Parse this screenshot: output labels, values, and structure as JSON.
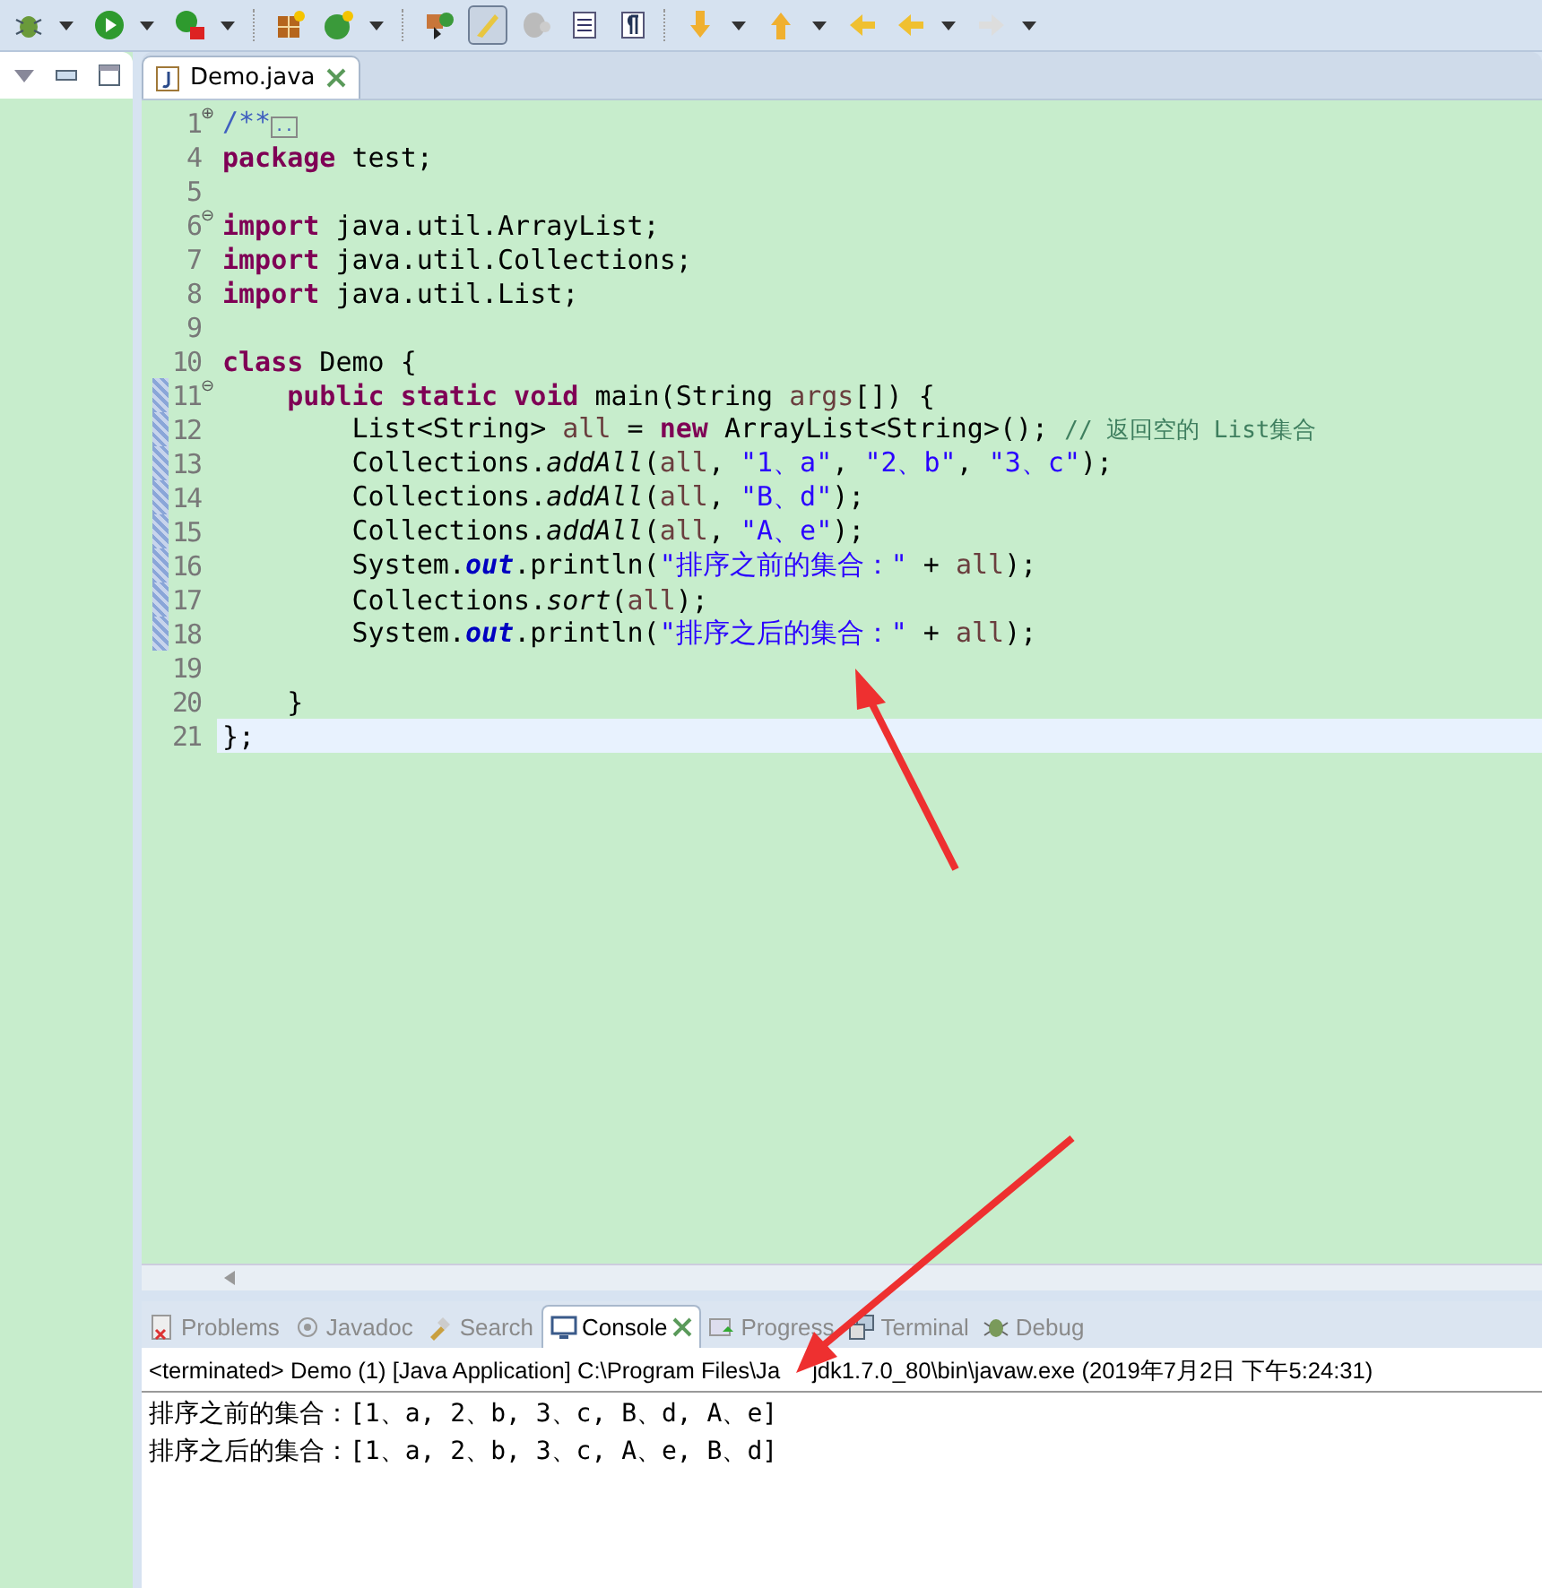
{
  "editor": {
    "tabs": [
      {
        "label": "Demo.java",
        "selected": true
      }
    ],
    "lines": [
      {
        "number": "1",
        "fold_marker": "⊕",
        "changed": false,
        "current": false,
        "tokens": [
          {
            "kind": "doc",
            "text": "/**"
          },
          {
            "kind": "foldbox",
            "text": ".."
          }
        ]
      },
      {
        "number": "4",
        "changed": false,
        "current": false,
        "tokens": [
          {
            "kind": "kw",
            "text": "package"
          },
          {
            "kind": "plain",
            "text": " test;"
          }
        ]
      },
      {
        "number": "5",
        "changed": false,
        "current": false
      },
      {
        "number": "6",
        "fold_marker": "⊖",
        "changed": false,
        "current": false,
        "tokens": [
          {
            "kind": "kw",
            "text": "import"
          },
          {
            "kind": "plain",
            "text": " java.util.ArrayList;"
          }
        ]
      },
      {
        "number": "7",
        "changed": false,
        "current": false,
        "tokens": [
          {
            "kind": "kw",
            "text": "import"
          },
          {
            "kind": "plain",
            "text": " java.util.Collections;"
          }
        ]
      },
      {
        "number": "8",
        "changed": false,
        "current": false,
        "tokens": [
          {
            "kind": "kw",
            "text": "import"
          },
          {
            "kind": "plain",
            "text": " java.util.List;"
          }
        ]
      },
      {
        "number": "9",
        "changed": false,
        "current": false
      },
      {
        "number": "10",
        "changed": false,
        "current": false,
        "tokens": [
          {
            "kind": "kw",
            "text": "class"
          },
          {
            "kind": "plain",
            "text": " Demo {"
          }
        ]
      },
      {
        "number": "11",
        "fold_marker": "⊖",
        "changed": true,
        "current": false,
        "tokens": [
          {
            "kind": "kw",
            "text": "    public static void"
          },
          {
            "kind": "plain",
            "text": " main(String "
          },
          {
            "kind": "var",
            "text": "args"
          },
          {
            "kind": "plain",
            "text": "[]) {"
          }
        ]
      },
      {
        "number": "12",
        "changed": true,
        "current": false,
        "tokens": [
          {
            "kind": "plain",
            "text": "        List<String> "
          },
          {
            "kind": "var",
            "text": "all"
          },
          {
            "kind": "plain",
            "text": " = "
          },
          {
            "kind": "kw",
            "text": "new"
          },
          {
            "kind": "plain",
            "text": " ArrayList<String>(); "
          },
          {
            "kind": "comment",
            "text": "// 返回空的 List集合"
          }
        ]
      },
      {
        "number": "13",
        "changed": true,
        "current": false,
        "tokens": [
          {
            "kind": "plain",
            "text": "        Collections."
          },
          {
            "kind": "method",
            "text": "addAll"
          },
          {
            "kind": "plain",
            "text": "("
          },
          {
            "kind": "var",
            "text": "all"
          },
          {
            "kind": "plain",
            "text": ", "
          },
          {
            "kind": "str",
            "text": "\"1、a\""
          },
          {
            "kind": "plain",
            "text": ", "
          },
          {
            "kind": "str",
            "text": "\"2、b\""
          },
          {
            "kind": "plain",
            "text": ", "
          },
          {
            "kind": "str",
            "text": "\"3、c\""
          },
          {
            "kind": "plain",
            "text": ");"
          }
        ]
      },
      {
        "number": "14",
        "changed": true,
        "current": false,
        "tokens": [
          {
            "kind": "plain",
            "text": "        Collections."
          },
          {
            "kind": "method",
            "text": "addAll"
          },
          {
            "kind": "plain",
            "text": "("
          },
          {
            "kind": "var",
            "text": "all"
          },
          {
            "kind": "plain",
            "text": ", "
          },
          {
            "kind": "str",
            "text": "\"B、d\""
          },
          {
            "kind": "plain",
            "text": ");"
          }
        ]
      },
      {
        "number": "15",
        "changed": true,
        "current": false,
        "tokens": [
          {
            "kind": "plain",
            "text": "        Collections."
          },
          {
            "kind": "method",
            "text": "addAll"
          },
          {
            "kind": "plain",
            "text": "("
          },
          {
            "kind": "var",
            "text": "all"
          },
          {
            "kind": "plain",
            "text": ", "
          },
          {
            "kind": "str",
            "text": "\"A、e\""
          },
          {
            "kind": "plain",
            "text": ");"
          }
        ]
      },
      {
        "number": "16",
        "changed": true,
        "current": false,
        "tokens": [
          {
            "kind": "plain",
            "text": "        System."
          },
          {
            "kind": "field",
            "text": "out"
          },
          {
            "kind": "plain",
            "text": ".println("
          },
          {
            "kind": "str",
            "text": "\"排序之前的集合：\""
          },
          {
            "kind": "plain",
            "text": " + "
          },
          {
            "kind": "var",
            "text": "all"
          },
          {
            "kind": "plain",
            "text": ");"
          }
        ]
      },
      {
        "number": "17",
        "changed": true,
        "current": false,
        "tokens": [
          {
            "kind": "plain",
            "text": "        Collections."
          },
          {
            "kind": "method",
            "text": "sort"
          },
          {
            "kind": "plain",
            "text": "("
          },
          {
            "kind": "var",
            "text": "all"
          },
          {
            "kind": "plain",
            "text": ");"
          }
        ]
      },
      {
        "number": "18",
        "changed": true,
        "current": false,
        "tokens": [
          {
            "kind": "plain",
            "text": "        System."
          },
          {
            "kind": "field",
            "text": "out"
          },
          {
            "kind": "plain",
            "text": ".println("
          },
          {
            "kind": "str",
            "text": "\"排序之后的集合：\""
          },
          {
            "kind": "plain",
            "text": " + "
          },
          {
            "kind": "var",
            "text": "all"
          },
          {
            "kind": "plain",
            "text": ");"
          }
        ]
      },
      {
        "number": "19",
        "changed": false,
        "current": false
      },
      {
        "number": "20",
        "changed": false,
        "current": false,
        "tokens": [
          {
            "kind": "plain",
            "text": "    }"
          }
        ]
      },
      {
        "number": "21",
        "changed": false,
        "current": true,
        "tokens": [
          {
            "kind": "plain",
            "text": "};"
          }
        ]
      }
    ]
  },
  "bottom_panel": {
    "tabs": [
      {
        "label": "Problems",
        "selected": false
      },
      {
        "label": "Javadoc",
        "selected": false
      },
      {
        "label": "Search",
        "selected": false
      },
      {
        "label": "Console",
        "selected": true
      },
      {
        "label": "Progress",
        "selected": false
      },
      {
        "label": "Terminal",
        "selected": false
      },
      {
        "label": "Debug",
        "selected": false
      }
    ],
    "console_header": [
      "<terminated> Demo (1) [Java Application] C:\\Program Files\\Ja",
      "jdk1.7.0_80\\bin\\javaw.exe (2019年7月2日 下午5:24:31)"
    ],
    "output": [
      "排序之前的集合：[1、a, 2、b, 3、c, B、d, A、e]",
      "排序之后的集合：[1、a, 2、b, 3、c, A、e, B、d]"
    ]
  }
}
